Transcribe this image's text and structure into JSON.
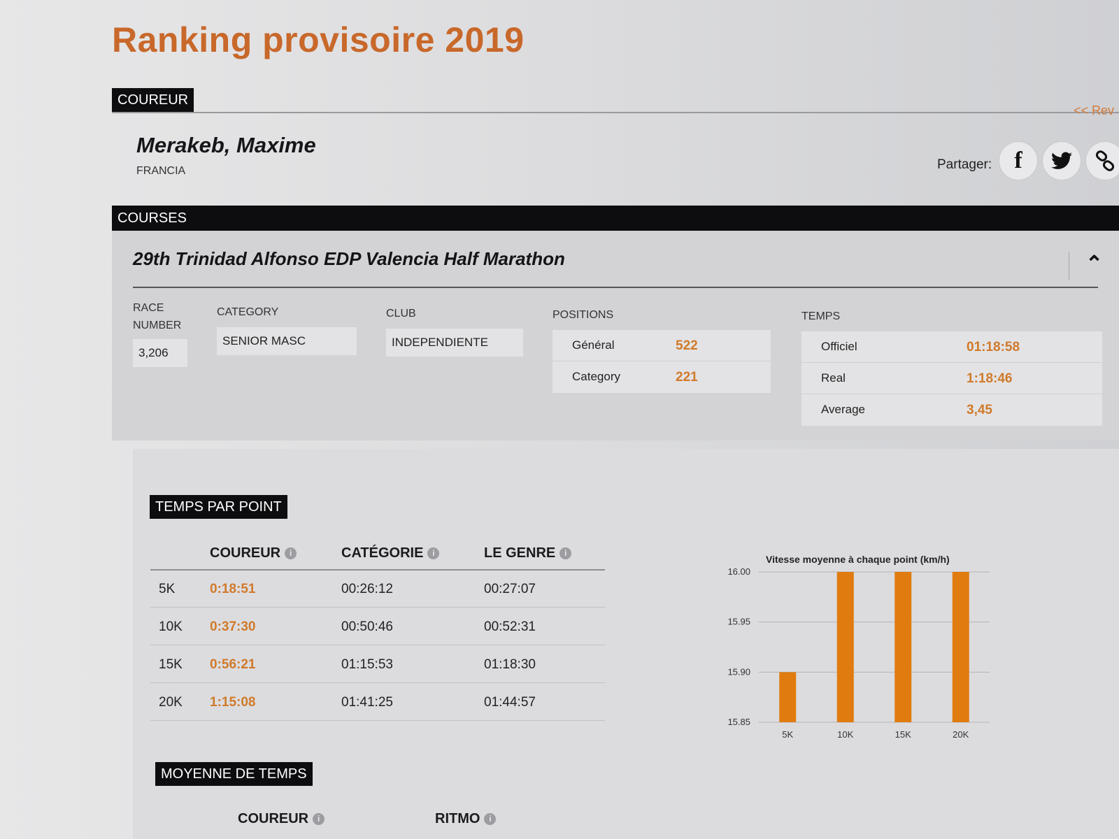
{
  "page": {
    "title": "Ranking provisoire 2019",
    "back_link": "<< Rev"
  },
  "runner": {
    "section_label": "COUREUR",
    "name": "Merakeb, Maxime",
    "country": "FRANCIA",
    "share_label": "Partager:",
    "share_icons": [
      "facebook-icon",
      "twitter-icon",
      "link-icon"
    ]
  },
  "courses": {
    "section_label": "COURSES",
    "race_title": "29th Trinidad Alfonso EDP Valencia Half Marathon",
    "race_number_label_1": "RACE",
    "race_number_label_2": "NUMBER",
    "race_number": "3,206",
    "category_label": "CATEGORY",
    "category": "SENIOR MASC",
    "club_label": "CLUB",
    "club": "INDEPENDIENTE",
    "positions_label": "POSITIONS",
    "positions": [
      {
        "label": "Général",
        "value": "522"
      },
      {
        "label": "Category",
        "value": "221"
      }
    ],
    "temps_label": "TEMPS",
    "temps": [
      {
        "label": "Officiel",
        "value": "01:18:58"
      },
      {
        "label": "Real",
        "value": "1:18:46"
      },
      {
        "label": "Average",
        "value": "3,45"
      }
    ]
  },
  "splits": {
    "section_label": "TEMPS PAR POINT",
    "headers": {
      "coureur": "COUREUR",
      "categorie": "CATÉGORIE",
      "genre": "LE GENRE"
    },
    "rows": [
      {
        "point": "5K",
        "coureur": "0:18:51",
        "categorie": "00:26:12",
        "genre": "00:27:07"
      },
      {
        "point": "10K",
        "coureur": "0:37:30",
        "categorie": "00:50:46",
        "genre": "00:52:31"
      },
      {
        "point": "15K",
        "coureur": "0:56:21",
        "categorie": "01:15:53",
        "genre": "01:18:30"
      },
      {
        "point": "20K",
        "coureur": "1:15:08",
        "categorie": "01:41:25",
        "genre": "01:44:57"
      }
    ]
  },
  "average": {
    "section_label": "MOYENNE DE TEMPS",
    "headers": {
      "coureur": "COUREUR",
      "ritmo": "RITMO"
    }
  },
  "colors": {
    "accent": "#d07a2a",
    "bar": "#e07b0f",
    "dark": "#0d0d10"
  },
  "chart_data": {
    "type": "bar",
    "title": "Vitesse moyenne à chaque point (km/h)",
    "categories": [
      "5K",
      "10K",
      "15K",
      "20K"
    ],
    "values": [
      15.9,
      16.0,
      16.0,
      16.0
    ],
    "ylim": [
      15.85,
      16.0
    ],
    "yticks": [
      "16.00",
      "15.95",
      "15.90",
      "15.85"
    ],
    "grid": true,
    "xlabel": "",
    "ylabel": ""
  }
}
